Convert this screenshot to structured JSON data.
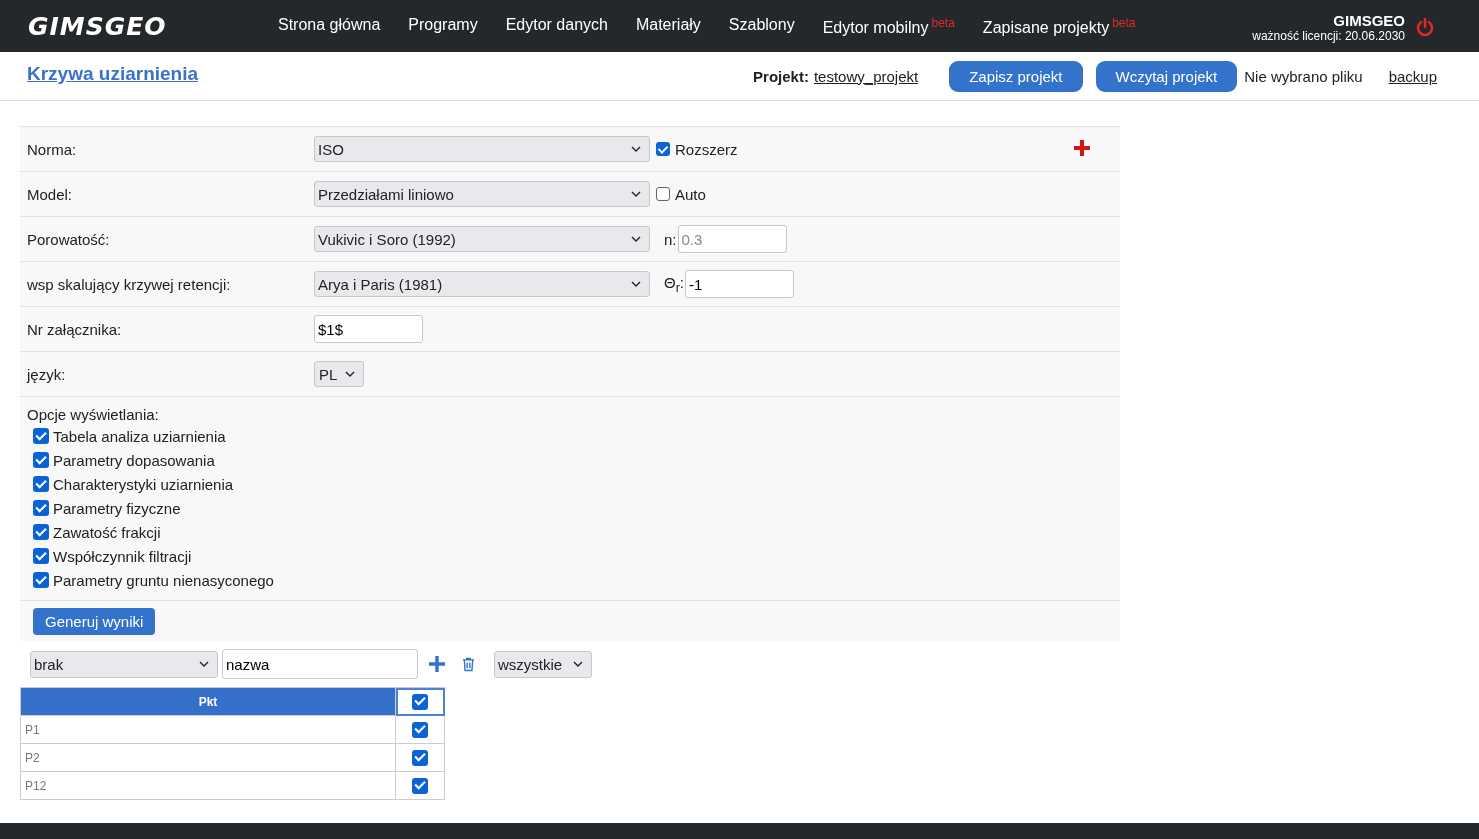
{
  "header": {
    "logo": "GIMSGEO",
    "nav": [
      {
        "label": "Strona główna"
      },
      {
        "label": "Programy"
      },
      {
        "label": "Edytor danych"
      },
      {
        "label": "Materiały"
      },
      {
        "label": "Szablony"
      },
      {
        "label": "Edytor mobilny",
        "badge": "beta"
      },
      {
        "label": "Zapisane projekty",
        "badge": "beta"
      }
    ],
    "user": "GIMSGEO",
    "license": "ważność licencji: 20.06.2030"
  },
  "subheader": {
    "title": "Krzywa uziarnienia",
    "project_label": "Projekt:",
    "project_name": "testowy_projekt",
    "buttons": [
      "Zapisz projekt",
      "Wczytaj projekt"
    ],
    "file_status": "Nie wybrano pliku",
    "backup_link": "backup"
  },
  "form": {
    "rows": [
      {
        "label": "Norma:",
        "kind": "select",
        "value": "ISO",
        "extra": {
          "kind": "checkbox",
          "label": "Rozszerz",
          "checked": true
        }
      },
      {
        "label": "Model:",
        "kind": "select",
        "value": "Przedziałami liniowo",
        "extra": {
          "kind": "checkbox",
          "label": "Auto",
          "checked": false
        }
      },
      {
        "label": "Porowatość:",
        "kind": "select",
        "value": "Vukivic i Soro (1992)",
        "extra": {
          "kind": "input",
          "prefix": "n:",
          "placeholder": "0.3"
        }
      },
      {
        "label": "wsp skalujący krzywej retencji:",
        "kind": "select",
        "value": "Arya i Paris (1981)",
        "extra": {
          "kind": "input",
          "prefix": "Θ$_{r}$:",
          "value": "-1"
        }
      },
      {
        "label": "Nr załącznika:",
        "kind": "input",
        "value": "$1$"
      },
      {
        "label": "język:",
        "kind": "small-select",
        "value": "PL"
      }
    ],
    "display_options": {
      "title": "Opcje wyświetlania:",
      "items": [
        {
          "label": "Tabela analiza uziarnienia",
          "checked": true
        },
        {
          "label": "Parametry dopasowania",
          "checked": true
        },
        {
          "label": "Charakterystyki uziarnienia",
          "checked": true
        },
        {
          "label": "Parametry fizyczne",
          "checked": true
        },
        {
          "label": "Zawatość frakcji",
          "checked": true
        },
        {
          "label": "Współczynnik filtracji",
          "checked": true
        },
        {
          "label": "Parametry gruntu nienasyconego",
          "checked": true
        }
      ]
    },
    "generate_button": "Generuj wyniki"
  },
  "toolbar": {
    "select": "brak",
    "name_field": "nazwa",
    "filter": "wszystkie"
  },
  "table": {
    "columns": [
      {
        "label": "Pkt"
      },
      {
        "checked": true
      }
    ],
    "rows": [
      {
        "name": "P1",
        "checked": true
      },
      {
        "name": "P2",
        "checked": true
      },
      {
        "name": "P12",
        "checked": true
      }
    ]
  }
}
